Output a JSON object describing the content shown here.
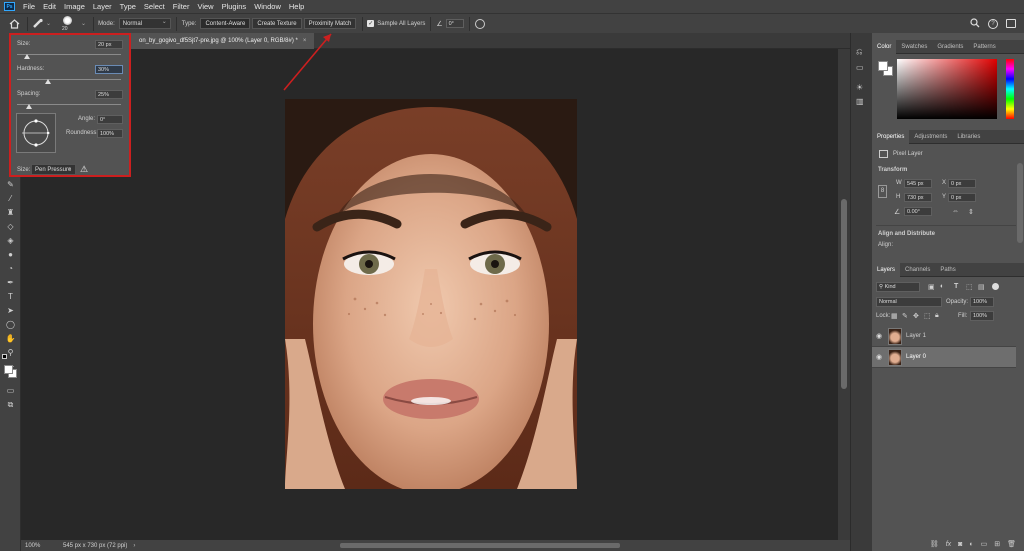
{
  "menu": {
    "app_logo": "Ps",
    "items": [
      "File",
      "Edit",
      "Image",
      "Layer",
      "Type",
      "Select",
      "Filter",
      "View",
      "Plugins",
      "Window",
      "Help"
    ]
  },
  "options": {
    "brush_size": "20",
    "mode_label": "Mode:",
    "mode_value": "Normal",
    "type_label": "Type:",
    "type_buttons": [
      "Content-Aware",
      "Create Texture",
      "Proximity Match"
    ],
    "sample_all_layers": "Sample All Layers",
    "angle_value": "0°"
  },
  "document": {
    "tab_title": "on_by_gogivo_df5Sjt7-pre.jpg @ 100% (Layer 0, RGB/8#) *",
    "close": "×"
  },
  "status": {
    "zoom": "100%",
    "info": "545 px x 730 px (72 ppi)"
  },
  "brush_popup": {
    "size_label": "Size:",
    "size_value": "20 px",
    "size_level": 0.1,
    "hardness_label": "Hardness:",
    "hardness_value": "30%",
    "hardness_level": 0.3,
    "spacing_label": "Spacing:",
    "spacing_value": "25%",
    "spacing_level": 0.12,
    "angle_label": "Angle:",
    "angle_value": "0°",
    "roundness_label": "Roundness:",
    "roundness_value": "100%",
    "size_control_label": "Size:",
    "size_control_value": "Pen Pressure"
  },
  "color_panel": {
    "tabs": [
      "Color",
      "Swatches",
      "Gradients",
      "Patterns"
    ]
  },
  "properties_panel": {
    "tabs": [
      "Properties",
      "Adjustments",
      "Libraries"
    ],
    "layer_type": "Pixel Layer",
    "transform_title": "Transform",
    "w_label": "W",
    "w_value": "545 px",
    "h_label": "H",
    "h_value": "730 px",
    "x_label": "X",
    "x_value": "0 px",
    "y_label": "Y",
    "y_value": "0 px",
    "angle_value": "0.00°",
    "align_title": "Align and Distribute",
    "align_label": "Align:"
  },
  "layers_panel": {
    "tabs": [
      "Layers",
      "Channels",
      "Paths"
    ],
    "filter_kind": "Kind",
    "blend_mode": "Normal",
    "opacity_label": "Opacity:",
    "opacity_value": "100%",
    "lock_label": "Lock:",
    "fill_label": "Fill:",
    "fill_value": "100%",
    "layers": [
      {
        "name": "Layer 1",
        "selected": false
      },
      {
        "name": "Layer 0",
        "selected": true
      }
    ],
    "footer_fx": "fx"
  },
  "colors": {
    "highlight_red": "#cc1f1f",
    "accent_blue": "#31a8ff"
  }
}
